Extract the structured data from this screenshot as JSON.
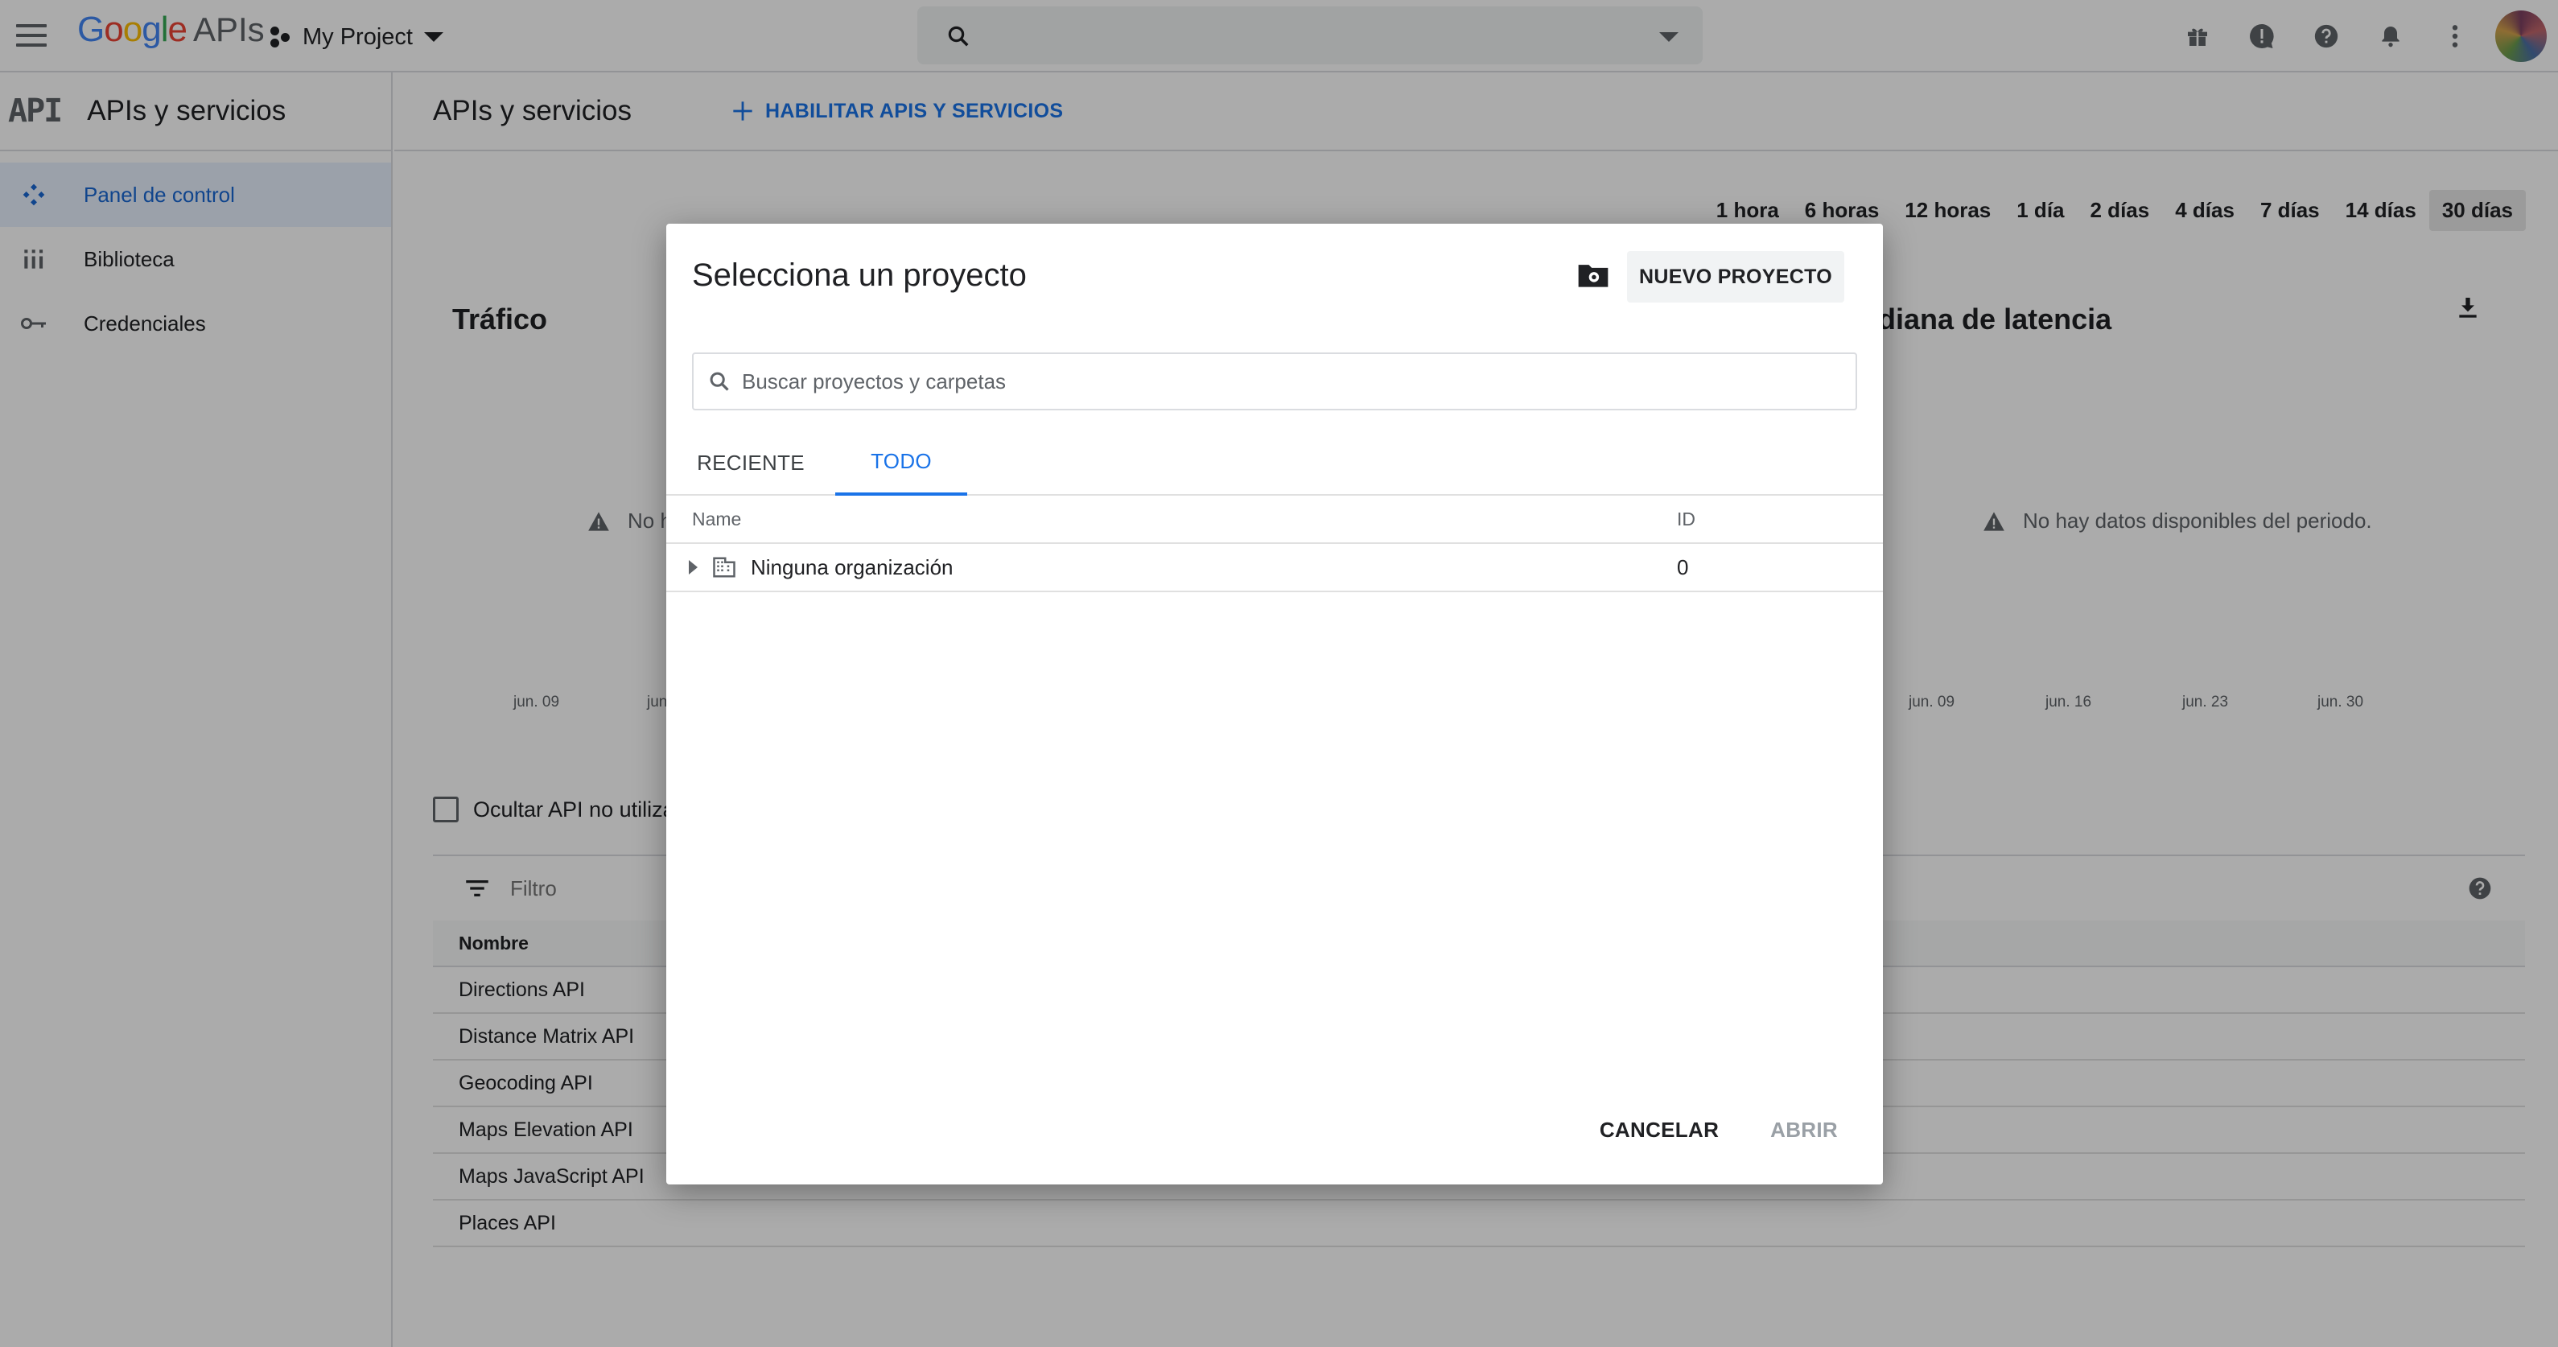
{
  "topbar": {
    "logo": {
      "g1": "G",
      "g2": "o",
      "g3": "o",
      "g4": "g",
      "g5": "l",
      "g6": "e",
      "apis": "APIs"
    },
    "project_name": "My Project",
    "icons": [
      "gift-icon",
      "feedback-icon",
      "help-icon",
      "notifications-icon",
      "more-vert-icon",
      "avatar"
    ]
  },
  "sidebar": {
    "logo": "API",
    "title": "APIs y servicios",
    "items": [
      {
        "label": "Panel de control",
        "icon": "dashboard-icon",
        "active": true
      },
      {
        "label": "Biblioteca",
        "icon": "library-icon",
        "active": false
      },
      {
        "label": "Credenciales",
        "icon": "key-icon",
        "active": false
      }
    ]
  },
  "main": {
    "title": "APIs y servicios",
    "enable_label": "HABILITAR APIS Y SERVICIOS",
    "ranges": [
      "1 hora",
      "6 horas",
      "12 horas",
      "1 día",
      "2 días",
      "4 días",
      "7 días",
      "14 días",
      "30 días"
    ],
    "selected_range": "30 días",
    "traffic_title": "Tráfico",
    "traffic_nodata_partial": "No h",
    "latency_title": "ediana de latencia",
    "latency_nodata": "No hay datos disponibles del periodo.",
    "left_ticks": [
      "jun. 09",
      "jun"
    ],
    "right_ticks": [
      "jun. 09",
      "jun. 16",
      "jun. 23",
      "jun. 30"
    ],
    "hide_unused_label": "Ocultar API no utiliza",
    "filter_label": "Filtro",
    "table_header": "Nombre",
    "apis": [
      "Directions API",
      "Distance Matrix API",
      "Geocoding API",
      "Maps Elevation API",
      "Maps JavaScript API",
      "Places API"
    ]
  },
  "dialog": {
    "title": "Selecciona un proyecto",
    "new_project_label": "NUEVO PROYECTO",
    "search_placeholder": "Buscar proyectos y carpetas",
    "tabs": [
      "RECIENTE",
      "TODO"
    ],
    "active_tab": "TODO",
    "columns": {
      "name": "Name",
      "id": "ID"
    },
    "rows": [
      {
        "name": "Ninguna organización",
        "id": "0"
      }
    ],
    "cancel_label": "CANCELAR",
    "open_label": "ABRIR"
  },
  "colors": {
    "accent": "#1a73e8",
    "active_bg": "#e8f0fe",
    "scrim": "rgba(0,0,0,0.33)"
  }
}
